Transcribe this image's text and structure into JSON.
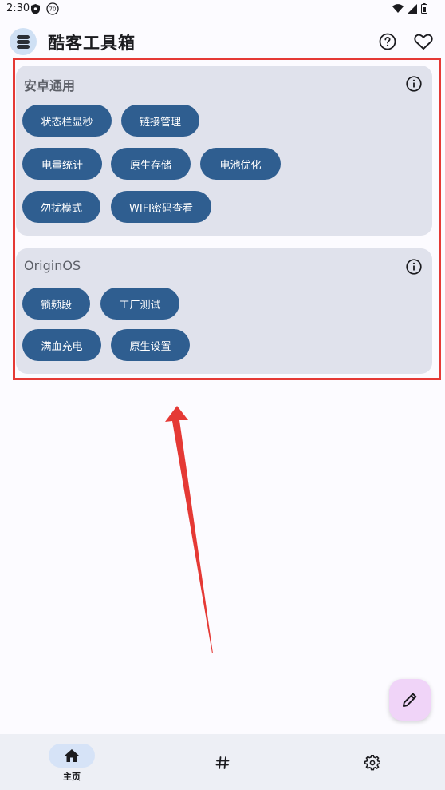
{
  "status_bar": {
    "time": "2:30",
    "badge": "70"
  },
  "app_bar": {
    "title": "酷客工具箱"
  },
  "sections": [
    {
      "title": "安卓通用",
      "chips": [
        "状态栏显秒",
        "链接管理",
        "电量统计",
        "原生存储",
        "电池优化",
        "勿扰模式",
        "WIFI密码查看"
      ]
    },
    {
      "title": "OriginOS",
      "chips": [
        "锁频段",
        "工厂测试",
        "满血充电",
        "原生设置"
      ]
    }
  ],
  "bottom_nav": {
    "home_label": "主页"
  },
  "colors": {
    "chip_bg": "#2F5E90",
    "card_bg": "#E0E2EC",
    "highlight": "#E53935",
    "fab_bg": "#F0D4F8",
    "nav_bg": "#EDEFF5"
  },
  "icons": [
    "shield-icon",
    "badge-70-icon",
    "wifi-icon",
    "signal-icon",
    "battery-icon",
    "app-logo-icon",
    "help-circle-icon",
    "heart-icon",
    "info-icon",
    "edit-pencil-icon",
    "home-icon",
    "hash-icon",
    "settings-gear-icon"
  ]
}
